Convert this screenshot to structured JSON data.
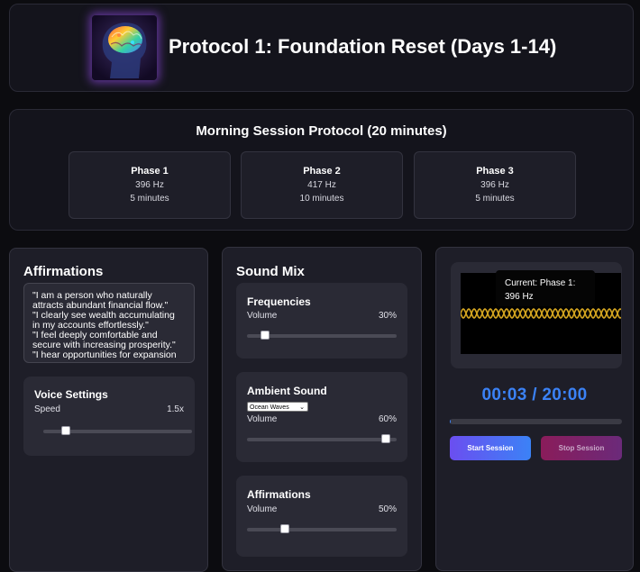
{
  "header": {
    "title": "Protocol 1: Foundation Reset (Days 1-14)",
    "logo_icon": "brain-icon"
  },
  "protocol": {
    "title": "Morning Session Protocol (20 minutes)",
    "phases": [
      {
        "title": "Phase 1",
        "frequency": "396 Hz",
        "duration": "5 minutes"
      },
      {
        "title": "Phase 2",
        "frequency": "417 Hz",
        "duration": "10 minutes"
      },
      {
        "title": "Phase 3",
        "frequency": "396 Hz",
        "duration": "5 minutes"
      }
    ]
  },
  "affirmations_panel": {
    "title": "Affirmations",
    "lines": [
      "\"I am a person who naturally",
      "attracts abundant financial flow.\"",
      "\"I clearly see wealth accumulating",
      "in my accounts effortlessly.\"",
      "\"I feel deeply comfortable and",
      "secure with increasing prosperity.\"",
      "\"I hear opportunities for expansion"
    ],
    "voice": {
      "title": "Voice Settings",
      "speed_label": "Speed",
      "speed_value": "1.5x",
      "speed_fraction": 0.15
    }
  },
  "sound_mix": {
    "title": "Sound Mix",
    "frequencies": {
      "title": "Frequencies",
      "volume_label": "Volume",
      "volume_value": "30%",
      "volume_fraction": 0.12
    },
    "ambient": {
      "title": "Ambient Sound",
      "selected": "Ocean Waves",
      "volume_label": "Volume",
      "volume_value": "60%",
      "volume_fraction": 0.93
    },
    "affirmations": {
      "title": "Affirmations",
      "volume_label": "Volume",
      "volume_value": "50%",
      "volume_fraction": 0.25
    }
  },
  "player": {
    "current_label": "Current: Phase 1: 396 Hz",
    "timer": "00:03 / 20:00",
    "progress_fraction": 0.0025,
    "start_label": "Start Session",
    "stop_label": "Stop Session",
    "accent": "#3b82f6"
  }
}
